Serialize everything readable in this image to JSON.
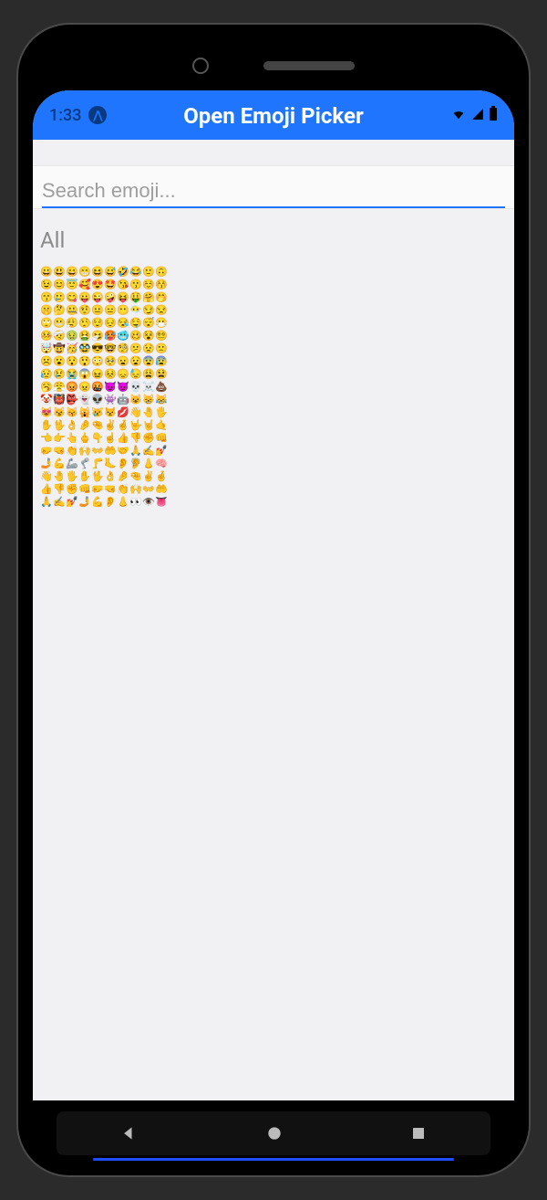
{
  "status": {
    "time": "1:33",
    "icons": [
      "wifi",
      "signal",
      "battery"
    ]
  },
  "header": {
    "title": "Open Emoji Picker"
  },
  "search": {
    "placeholder": "Search emoji...",
    "value": ""
  },
  "section": {
    "label": "All"
  },
  "emoji_rows": [
    [
      "😀",
      "😃",
      "😄",
      "😁",
      "😆",
      "😅",
      "🤣",
      "😂",
      "🙂",
      "🙃"
    ],
    [
      "😉",
      "😊",
      "😇",
      "🥰",
      "😍",
      "🤩",
      "😘",
      "😗",
      "☺️",
      "😚"
    ],
    [
      "😙",
      "🥲",
      "😋",
      "😛",
      "😜",
      "🤪",
      "😝",
      "🤑",
      "🤗",
      "🤭"
    ],
    [
      "🤫",
      "🤔",
      "🤐",
      "🤨",
      "😐",
      "😑",
      "😶",
      "😶‍🌫️",
      "😏",
      "😒"
    ],
    [
      "🙄",
      "😬",
      "😮‍💨",
      "🤥",
      "😌",
      "😔",
      "😪",
      "🤤",
      "😴",
      "😷"
    ],
    [
      "🤒",
      "🤕",
      "🤢",
      "🤮",
      "🤧",
      "🥵",
      "🥶",
      "🥴",
      "😵",
      "😵‍💫"
    ],
    [
      "🤯",
      "🤠",
      "🥳",
      "🥸",
      "😎",
      "🤓",
      "🧐",
      "😕",
      "😟",
      "🙁"
    ],
    [
      "☹️",
      "😮",
      "😯",
      "😲",
      "😳",
      "🥺",
      "😦",
      "😧",
      "😨",
      "😰"
    ],
    [
      "😥",
      "😢",
      "😭",
      "😱",
      "😖",
      "😣",
      "😞",
      "😓",
      "😩",
      "😫"
    ],
    [
      "🥱",
      "😤",
      "😡",
      "😠",
      "🤬",
      "😈",
      "👿",
      "💀",
      "☠️",
      "💩"
    ],
    [
      "🤡",
      "👹",
      "👺",
      "👻",
      "👽",
      "👾",
      "🤖",
      "😺",
      "😸",
      "😹"
    ],
    [
      "😻",
      "😼",
      "😽",
      "🙀",
      "😿",
      "😾",
      "💋",
      "👋",
      "🤚",
      "🖐️"
    ],
    [
      "✋",
      "🖖",
      "👌",
      "🤌",
      "🤏",
      "✌️",
      "🤞",
      "🤟",
      "🤘",
      "🤙"
    ],
    [
      "👈",
      "👉",
      "👆",
      "🖕",
      "👇",
      "☝️",
      "👍",
      "👎",
      "✊",
      "👊"
    ],
    [
      "🤛",
      "🤜",
      "👏",
      "🙌",
      "👐",
      "🤲",
      "🤝",
      "🙏",
      "✍️",
      "💅"
    ],
    [
      "🤳",
      "💪",
      "🦾",
      "🦿",
      "🦵",
      "🦶",
      "👂",
      "🦻",
      "👃",
      "🧠"
    ],
    [
      "👋",
      "🤚",
      "🖐️",
      "✋",
      "🖖",
      "👌",
      "🤌",
      "🤏",
      "✌️",
      "🤞"
    ],
    [
      "👍",
      "👎",
      "✊",
      "👊",
      "🤛",
      "🤜",
      "👏",
      "🙌",
      "👐",
      "🤲"
    ],
    [
      "🙏",
      "✍️",
      "💅",
      "🤳",
      "💪",
      "👂",
      "👃",
      "👀",
      "👁️",
      "👅"
    ]
  ],
  "nav": {
    "buttons": [
      "back",
      "home",
      "recent"
    ]
  }
}
